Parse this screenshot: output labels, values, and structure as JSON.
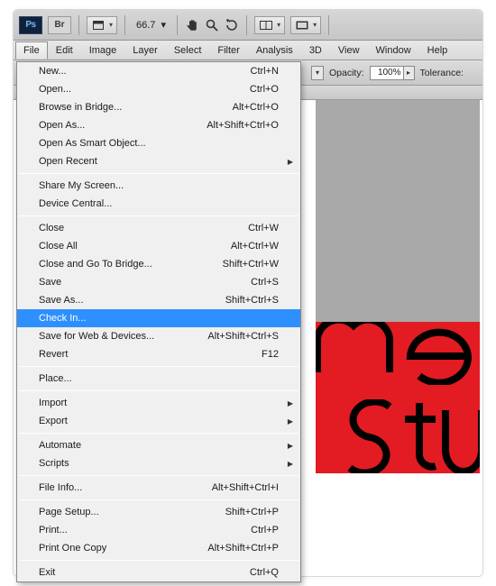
{
  "toolbar": {
    "ps": "Ps",
    "br": "Br",
    "zoom": "66.7"
  },
  "menubar": [
    "File",
    "Edit",
    "Image",
    "Layer",
    "Select",
    "Filter",
    "Analysis",
    "3D",
    "View",
    "Window",
    "Help"
  ],
  "optionsbar": {
    "opacity_label": "Opacity:",
    "opacity_value": "100%",
    "tol_label": "Tolerance:"
  },
  "file_menu": [
    {
      "t": "item",
      "label": "New...",
      "shortcut": "Ctrl+N"
    },
    {
      "t": "item",
      "label": "Open...",
      "shortcut": "Ctrl+O"
    },
    {
      "t": "item",
      "label": "Browse in Bridge...",
      "shortcut": "Alt+Ctrl+O"
    },
    {
      "t": "item",
      "label": "Open As...",
      "shortcut": "Alt+Shift+Ctrl+O"
    },
    {
      "t": "item",
      "label": "Open As Smart Object..."
    },
    {
      "t": "item",
      "label": "Open Recent",
      "sub": true
    },
    {
      "t": "sep"
    },
    {
      "t": "item",
      "label": "Share My Screen..."
    },
    {
      "t": "item",
      "label": "Device Central..."
    },
    {
      "t": "sep"
    },
    {
      "t": "item",
      "label": "Close",
      "shortcut": "Ctrl+W"
    },
    {
      "t": "item",
      "label": "Close All",
      "shortcut": "Alt+Ctrl+W"
    },
    {
      "t": "item",
      "label": "Close and Go To Bridge...",
      "shortcut": "Shift+Ctrl+W"
    },
    {
      "t": "item",
      "label": "Save",
      "shortcut": "Ctrl+S"
    },
    {
      "t": "item",
      "label": "Save As...",
      "shortcut": "Shift+Ctrl+S"
    },
    {
      "t": "item",
      "label": "Check In...",
      "hl": true
    },
    {
      "t": "item",
      "label": "Save for Web & Devices...",
      "shortcut": "Alt+Shift+Ctrl+S"
    },
    {
      "t": "item",
      "label": "Revert",
      "shortcut": "F12"
    },
    {
      "t": "sep"
    },
    {
      "t": "item",
      "label": "Place..."
    },
    {
      "t": "sep"
    },
    {
      "t": "item",
      "label": "Import",
      "sub": true
    },
    {
      "t": "item",
      "label": "Export",
      "sub": true
    },
    {
      "t": "sep"
    },
    {
      "t": "item",
      "label": "Automate",
      "sub": true
    },
    {
      "t": "item",
      "label": "Scripts",
      "sub": true
    },
    {
      "t": "sep"
    },
    {
      "t": "item",
      "label": "File Info...",
      "shortcut": "Alt+Shift+Ctrl+I"
    },
    {
      "t": "sep"
    },
    {
      "t": "item",
      "label": "Page Setup...",
      "shortcut": "Shift+Ctrl+P"
    },
    {
      "t": "item",
      "label": "Print...",
      "shortcut": "Ctrl+P"
    },
    {
      "t": "item",
      "label": "Print One Copy",
      "shortcut": "Alt+Shift+Ctrl+P"
    },
    {
      "t": "sep"
    },
    {
      "t": "item",
      "label": "Exit",
      "shortcut": "Ctrl+Q"
    }
  ]
}
